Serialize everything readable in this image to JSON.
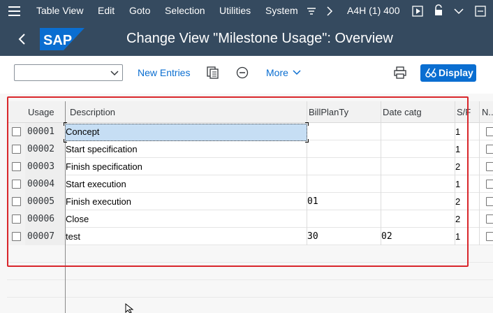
{
  "menu": {
    "items": [
      "Table View",
      "Edit",
      "Goto",
      "Selection",
      "Utilities",
      "System"
    ],
    "system_id": "A4H (1) 400"
  },
  "title": {
    "logo_text": "SAP",
    "page_title": "Change View \"Milestone Usage\": Overview"
  },
  "toolbar": {
    "select_value": "",
    "new_entries": "New Entries",
    "more": "More",
    "display": "Display"
  },
  "table": {
    "columns": [
      "Usage",
      "Description",
      "BillPlanTy",
      "Date catg",
      "S/F",
      "N..."
    ],
    "rows": [
      {
        "usage": "00001",
        "description": "Concept",
        "billplanty": "",
        "datecatg": "",
        "sf": "1"
      },
      {
        "usage": "00002",
        "description": "Start specification",
        "billplanty": "",
        "datecatg": "",
        "sf": "1"
      },
      {
        "usage": "00003",
        "description": "Finish specification",
        "billplanty": "",
        "datecatg": "",
        "sf": "2"
      },
      {
        "usage": "00004",
        "description": "Start execution",
        "billplanty": "",
        "datecatg": "",
        "sf": "1"
      },
      {
        "usage": "00005",
        "description": "Finish execution",
        "billplanty": "01",
        "datecatg": "",
        "sf": "2"
      },
      {
        "usage": "00006",
        "description": "Close",
        "billplanty": "",
        "datecatg": "",
        "sf": "2"
      },
      {
        "usage": "00007",
        "description": "test",
        "billplanty": "30",
        "datecatg": "02",
        "sf": "1"
      }
    ]
  },
  "colors": {
    "shell": "#354a5f",
    "accent": "#0a6ed1",
    "highlight_box": "#d9262b",
    "selected_cell": "#c6def4"
  }
}
